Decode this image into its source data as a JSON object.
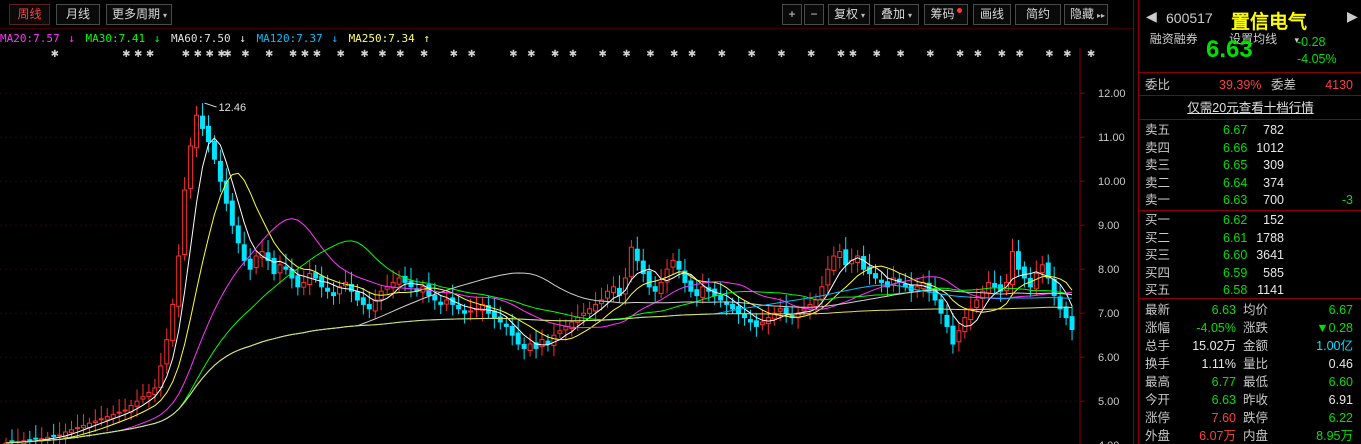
{
  "toolbar": {
    "left_buttons": [
      "周线",
      "月线",
      "更多周期"
    ],
    "right_buttons": [
      "+",
      "−",
      "复权",
      "叠加",
      "筹码",
      "画线",
      "简约",
      "隐藏"
    ],
    "more_period_arrow": "▾",
    "fq_arrow": "▾",
    "overlay_arrow": "▾",
    "hide_arrow": "▸▸"
  },
  "ma_line": [
    {
      "text": "MA20:7.57",
      "arrow": "↓",
      "color": "#ff33ff"
    },
    {
      "text": "MA30:7.41",
      "arrow": "↓",
      "color": "#00ff00"
    },
    {
      "text": "MA60:7.50",
      "arrow": "↓",
      "color": "#e0e0e0"
    },
    {
      "text": "MA120:7.37",
      "arrow": "↓",
      "color": "#00bfff"
    },
    {
      "text": "MA250:7.34",
      "arrow": "↑",
      "color": "#ffff66"
    }
  ],
  "ma_tools": {
    "financing": "融资融券",
    "ma_settings": "设置均线",
    "ma_settings_arrow": "▾"
  },
  "chart_data": {
    "type": "candlestick",
    "ylim": [
      3.8,
      12.8
    ],
    "y_ticks": [
      "12.00",
      "11.00",
      "10.00",
      "9.00",
      "8.00",
      "7.00",
      "6.00",
      "5.00",
      "4.00"
    ],
    "max_label": "12.46",
    "closes": [
      4.05,
      4.07,
      4.08,
      4.1,
      4.12,
      4.14,
      4.15,
      4.18,
      4.2,
      4.23,
      4.3,
      4.35,
      4.4,
      4.45,
      4.5,
      4.55,
      4.6,
      4.65,
      4.7,
      4.75,
      4.8,
      4.9,
      5.0,
      5.1,
      5.2,
      5.3,
      5.8,
      6.4,
      7.2,
      8.3,
      9.8,
      10.8,
      11.5,
      11.2,
      10.9,
      10.5,
      10.0,
      9.5,
      9.0,
      8.6,
      8.2,
      8.0,
      8.3,
      8.4,
      8.2,
      7.9,
      8.1,
      8.0,
      7.8,
      7.6,
      7.7,
      7.9,
      7.8,
      7.6,
      7.5,
      7.4,
      7.6,
      7.7,
      7.5,
      7.3,
      7.2,
      7.1,
      7.3,
      7.5,
      7.6,
      7.7,
      7.8,
      7.7,
      7.6,
      7.5,
      7.6,
      7.4,
      7.3,
      7.2,
      7.3,
      7.2,
      7.1,
      7.0,
      7.05,
      7.1,
      7.2,
      7.0,
      6.9,
      6.8,
      6.7,
      6.5,
      6.3,
      6.2,
      6.3,
      6.2,
      6.4,
      6.3,
      6.5,
      6.6,
      6.7,
      6.8,
      6.9,
      7.0,
      7.1,
      7.2,
      7.3,
      7.5,
      7.6,
      7.4,
      7.8,
      8.5,
      8.2,
      7.9,
      7.6,
      7.5,
      7.7,
      8.0,
      8.2,
      8.0,
      7.7,
      7.5,
      7.4,
      7.6,
      7.5,
      7.4,
      7.3,
      7.2,
      7.1,
      7.0,
      6.9,
      6.8,
      6.7,
      6.8,
      6.9,
      7.0,
      7.1,
      7.0,
      6.9,
      7.0,
      7.1,
      7.2,
      7.3,
      7.6,
      8.0,
      8.3,
      8.4,
      8.1,
      8.2,
      8.3,
      8.0,
      7.9,
      7.8,
      7.7,
      7.6,
      7.8,
      7.7,
      7.6,
      7.5,
      7.6,
      7.7,
      7.5,
      7.3,
      7.0,
      6.7,
      6.3,
      6.6,
      6.9,
      7.1,
      7.3,
      7.5,
      7.7,
      7.6,
      7.5,
      7.7,
      8.4,
      8.0,
      7.8,
      7.6,
      7.9,
      8.1,
      7.8,
      7.4,
      7.1,
      6.9,
      6.63
    ],
    "ma_values": {
      "MA20": 7.57,
      "MA30": 7.41,
      "MA60": 7.5,
      "MA120": 7.37,
      "MA250": 7.34
    },
    "markers": [
      8,
      20,
      22,
      24,
      30,
      32,
      34,
      36,
      37,
      40,
      44,
      48,
      50,
      52,
      56,
      60,
      63,
      66,
      70,
      75,
      78,
      85,
      88,
      92,
      95,
      100,
      104,
      108,
      112,
      115,
      120,
      125,
      130,
      135,
      140,
      142,
      146,
      150,
      155,
      160,
      163,
      167,
      170,
      175,
      178,
      182
    ]
  },
  "quote": {
    "code": "600517",
    "name": "置信电气",
    "price": "6.63",
    "change": "-0.28",
    "pct": "-4.05%",
    "wei_bi_label": "委比",
    "wei_bi": "39.39%",
    "wei_cha_label": "委差",
    "wei_cha": "4130",
    "promo": "仅需20元查看十档行情",
    "sells": [
      {
        "label": "卖五",
        "price": "6.67",
        "vol": "782",
        "delta": ""
      },
      {
        "label": "卖四",
        "price": "6.66",
        "vol": "1012",
        "delta": ""
      },
      {
        "label": "卖三",
        "price": "6.65",
        "vol": "309",
        "delta": ""
      },
      {
        "label": "卖二",
        "price": "6.64",
        "vol": "374",
        "delta": ""
      },
      {
        "label": "卖一",
        "price": "6.63",
        "vol": "700",
        "delta": "-3"
      }
    ],
    "buys": [
      {
        "label": "买一",
        "price": "6.62",
        "vol": "152"
      },
      {
        "label": "买二",
        "price": "6.61",
        "vol": "1788"
      },
      {
        "label": "买三",
        "price": "6.60",
        "vol": "3641"
      },
      {
        "label": "买四",
        "price": "6.59",
        "vol": "585"
      },
      {
        "label": "买五",
        "price": "6.58",
        "vol": "1141"
      }
    ],
    "stats": [
      {
        "l1": "最新",
        "v1": "6.63",
        "c1": "green",
        "l2": "均价",
        "v2": "6.67",
        "c2": "green"
      },
      {
        "l1": "涨幅",
        "v1": "-4.05%",
        "c1": "green",
        "l2": "涨跌",
        "v2": "▼0.28",
        "c2": "green"
      },
      {
        "l1": "总手",
        "v1": "15.02万",
        "c1": "white",
        "l2": "金额",
        "v2": "1.00亿",
        "c2": "cyan"
      },
      {
        "l1": "换手",
        "v1": "1.11%",
        "c1": "white",
        "l2": "量比",
        "v2": "0.46",
        "c2": "white"
      },
      {
        "l1": "最高",
        "v1": "6.77",
        "c1": "green",
        "l2": "最低",
        "v2": "6.60",
        "c2": "green"
      },
      {
        "l1": "今开",
        "v1": "6.63",
        "c1": "green",
        "l2": "昨收",
        "v2": "6.91",
        "c2": "white"
      },
      {
        "l1": "涨停",
        "v1": "7.60",
        "c1": "red",
        "l2": "跌停",
        "v2": "6.22",
        "c2": "green"
      },
      {
        "l1": "外盘",
        "v1": "6.07万",
        "c1": "red",
        "l2": "内盘",
        "v2": "8.95万",
        "c2": "green"
      }
    ]
  }
}
